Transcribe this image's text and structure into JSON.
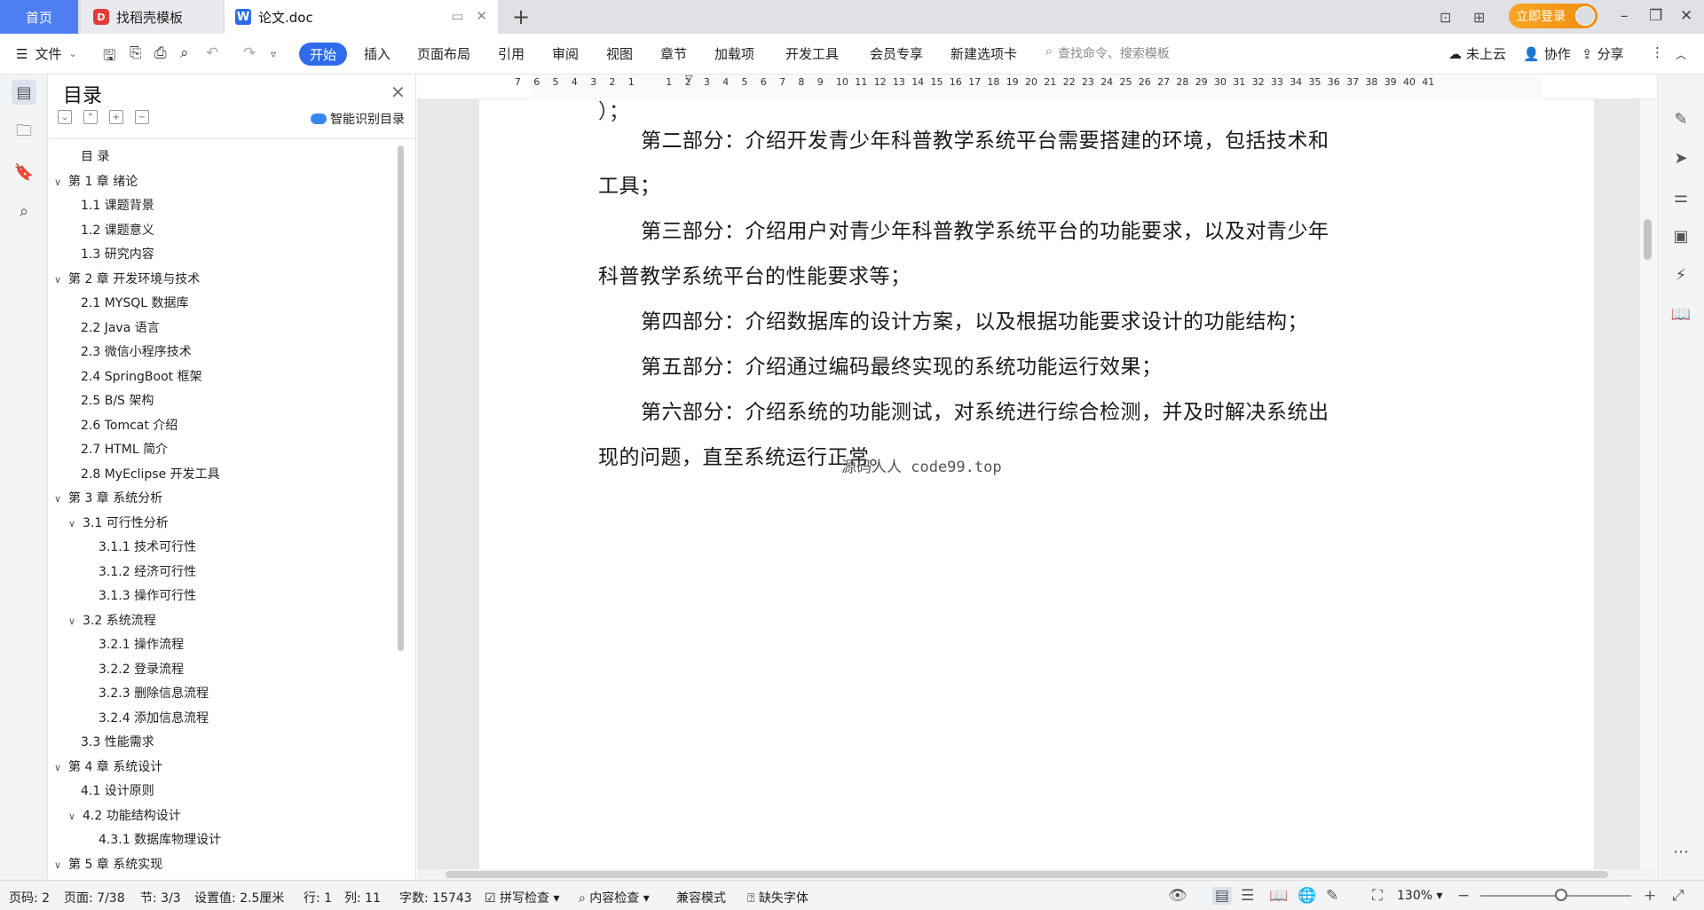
{
  "titlebar": {
    "tab_home": "首页",
    "tab_template": "找稻壳模板",
    "tab_doc": "论文.doc",
    "login": "立即登录"
  },
  "menubar": {
    "file": "文件",
    "items": [
      "开始",
      "插入",
      "页面布局",
      "引用",
      "审阅",
      "视图",
      "章节",
      "加载项",
      "开发工具",
      "会员专享",
      "新建选项卡"
    ],
    "search_placeholder": "查找命令、搜索模板",
    "cloud": "未上云",
    "collab": "协作",
    "share": "分享"
  },
  "toc": {
    "title": "目录",
    "smart": "智能识别目录",
    "items": [
      {
        "label": "目  录",
        "level": 1,
        "caret": ""
      },
      {
        "label": "第 1 章  绪论",
        "level": 0,
        "caret": "v"
      },
      {
        "label": "1.1  课题背景",
        "level": 1,
        "caret": ""
      },
      {
        "label": "1.2  课题意义",
        "level": 1,
        "caret": ""
      },
      {
        "label": "1.3  研究内容",
        "level": 1,
        "caret": ""
      },
      {
        "label": "第 2 章  开发环境与技术",
        "level": 0,
        "caret": "v"
      },
      {
        "label": "2.1 MYSQL 数据库",
        "level": 1,
        "caret": ""
      },
      {
        "label": "2.2 Java 语言",
        "level": 1,
        "caret": ""
      },
      {
        "label": "2.3  微信小程序技术",
        "level": 1,
        "caret": ""
      },
      {
        "label": "2.4 SpringBoot 框架",
        "level": 1,
        "caret": ""
      },
      {
        "label": "2.5 B/S 架构",
        "level": 1,
        "caret": ""
      },
      {
        "label": "2.6 Tomcat  介绍",
        "level": 1,
        "caret": ""
      },
      {
        "label": "2.7 HTML 简介",
        "level": 1,
        "caret": ""
      },
      {
        "label": "2.8 MyEclipse 开发工具",
        "level": 1,
        "caret": ""
      },
      {
        "label": "第 3 章  系统分析",
        "level": 0,
        "caret": "v"
      },
      {
        "label": "3.1  可行性分析",
        "level": 1,
        "caret": "v"
      },
      {
        "label": "3.1.1  技术可行性",
        "level": 2,
        "caret": ""
      },
      {
        "label": "3.1.2  经济可行性",
        "level": 2,
        "caret": ""
      },
      {
        "label": "3.1.3  操作可行性",
        "level": 2,
        "caret": ""
      },
      {
        "label": "3.2  系统流程",
        "level": 1,
        "caret": "v"
      },
      {
        "label": "3.2.1  操作流程",
        "level": 2,
        "caret": ""
      },
      {
        "label": "3.2.2  登录流程",
        "level": 2,
        "caret": ""
      },
      {
        "label": "3.2.3  删除信息流程",
        "level": 2,
        "caret": ""
      },
      {
        "label": "3.2.4  添加信息流程",
        "level": 2,
        "caret": ""
      },
      {
        "label": "3.3  性能需求",
        "level": 1,
        "caret": ""
      },
      {
        "label": "第 4 章  系统设计",
        "level": 0,
        "caret": "v"
      },
      {
        "label": "4.1  设计原则",
        "level": 1,
        "caret": ""
      },
      {
        "label": "4.2  功能结构设计",
        "level": 1,
        "caret": "v"
      },
      {
        "label": "4.3.1  数据库物理设计",
        "level": 2,
        "caret": ""
      },
      {
        "label": "第 5 章  系统实现",
        "level": 0,
        "caret": "v"
      }
    ]
  },
  "ruler": {
    "left_ticks": [
      "7",
      "6",
      "5",
      "4",
      "3",
      "2",
      "1"
    ],
    "right_ticks": [
      "1",
      "2",
      "3",
      "4",
      "5",
      "6",
      "7",
      "8",
      "9",
      "10",
      "11",
      "12",
      "13",
      "14",
      "15",
      "16",
      "17",
      "18",
      "19",
      "20",
      "21",
      "22",
      "23",
      "24",
      "25",
      "26",
      "27",
      "28",
      "29",
      "30",
      "31",
      "32",
      "33",
      "34",
      "35",
      "36",
      "37",
      "38",
      "39",
      "40",
      "41"
    ]
  },
  "document": {
    "lines": [
      "第二部分：介绍开发青少年科普教学系统平台需要搭建的环境，包括技术和",
      "工具；",
      "第三部分：介绍用户对青少年科普教学系统平台的功能要求，以及对青少年",
      "科普教学系统平台的性能要求等；",
      "第四部分：介绍数据库的设计方案，以及根据功能要求设计的功能结构；",
      "第五部分：介绍通过编码最终实现的系统功能运行效果；",
      "第六部分：介绍系统的功能测试，对系统进行综合检测，并及时解决系统出",
      "现的问题，直至系统运行正常。"
    ],
    "watermark": "源码人人 code99.top"
  },
  "status": {
    "page_code": "页码: 2",
    "page": "页面: 7/38",
    "section": "节: 3/3",
    "setting": "设置值: 2.5厘米",
    "row": "行: 1",
    "col": "列: 11",
    "words": "字数: 15743",
    "spell": "拼写检查",
    "content_check": "内容检查",
    "compat": "兼容模式",
    "missing_font": "缺失字体",
    "zoom": "130%"
  }
}
